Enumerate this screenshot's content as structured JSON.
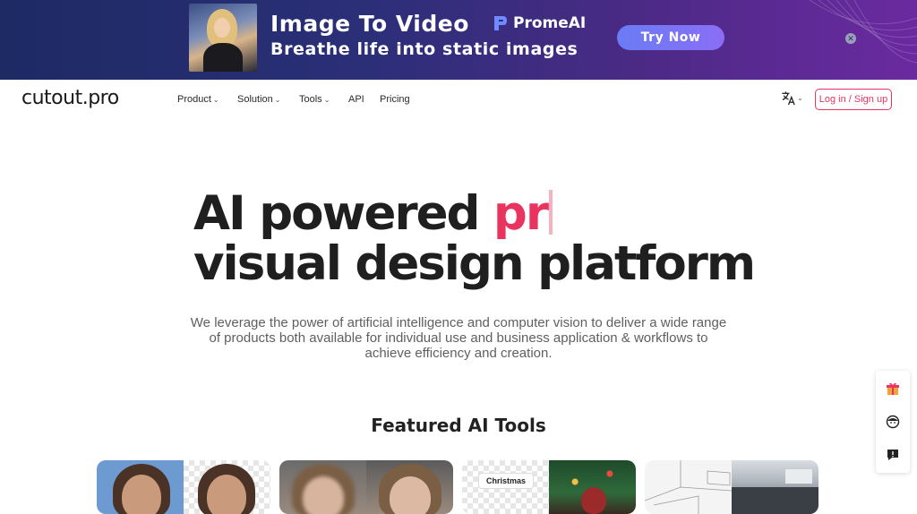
{
  "banner": {
    "title": "Image To Video",
    "subtitle": "Breathe life into static images",
    "brand": "PromeAI",
    "cta_label": "Try Now",
    "close_icon": "close-icon",
    "accent_color": "#7a75f5"
  },
  "nav": {
    "logo": "cutout.pro",
    "items": [
      {
        "label": "Product",
        "dropdown": true
      },
      {
        "label": "Solution",
        "dropdown": true
      },
      {
        "label": "Tools",
        "dropdown": true
      },
      {
        "label": "API",
        "dropdown": false
      },
      {
        "label": "Pricing",
        "dropdown": false
      }
    ],
    "language_icon": "translate-icon",
    "login_label": "Log in / Sign up",
    "brand_color": "#e8345f"
  },
  "hero": {
    "line1_prefix": "AI powered ",
    "line1_typed": "pr",
    "line2": "visual design platform",
    "description": "We leverage the power of artificial intelligence and computer vision to deliver a wide range of products both available for individual use and business application & workflows to achieve efficiency and creation."
  },
  "featured": {
    "title": "Featured AI Tools",
    "cards": [
      {
        "name": "background-remover-card"
      },
      {
        "name": "photo-enhancer-card"
      },
      {
        "name": "christmas-card",
        "tag": "Christmas"
      },
      {
        "name": "interior-design-card"
      }
    ]
  },
  "side_widgets": [
    "gift-icon",
    "support-chat-icon",
    "feedback-icon"
  ]
}
